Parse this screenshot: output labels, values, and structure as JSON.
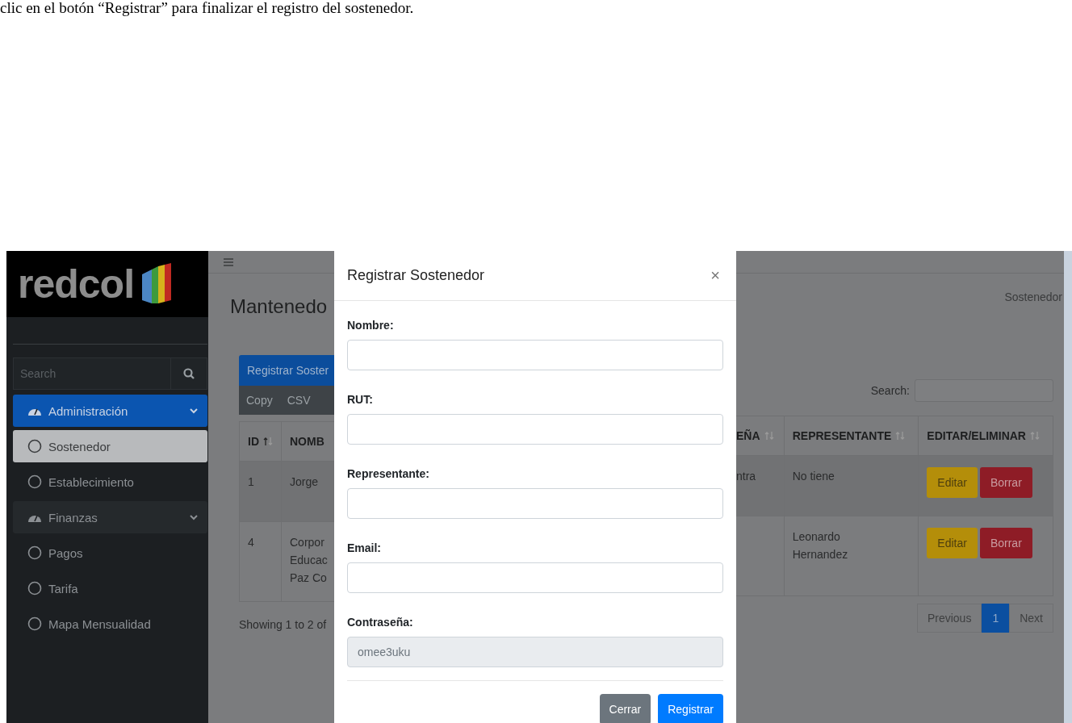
{
  "document_text": "clic en el botón “Registrar” para finalizar el registro del sostenedor.",
  "sidebar": {
    "logo": "redcol",
    "search": {
      "placeholder": "Search"
    },
    "items": [
      {
        "label": "Administración",
        "selected": true,
        "expanded": true,
        "children": [
          {
            "label": "Sostenedor",
            "selected": true
          },
          {
            "label": "Establecimiento",
            "selected": false
          }
        ]
      },
      {
        "label": "Finanzas",
        "selected": false,
        "expanded": true,
        "children": [
          {
            "label": "Pagos",
            "selected": false
          },
          {
            "label": "Tarifa",
            "selected": false
          },
          {
            "label": "Mapa Mensualidad",
            "selected": false
          }
        ]
      }
    ]
  },
  "page": {
    "title": "Mantenedo",
    "breadcrumb": "Sostenedor",
    "register_button": "Registrar Soster",
    "export_buttons": [
      "Copy",
      "CSV"
    ],
    "search_label": "Search:",
    "table_left": {
      "columns": [
        {
          "label": "ID",
          "sorted": true
        },
        {
          "label": "NOMB"
        }
      ],
      "rows": [
        {
          "cells": [
            "1",
            "Jorge"
          ]
        },
        {
          "cells": [
            "4",
            "Corpor\nEducac\nPaz Co"
          ]
        }
      ]
    },
    "table_right": {
      "columns": [
        {
          "label": "EÑA",
          "sorted": false
        },
        {
          "label": "REPRESENTANTE",
          "sorted": false
        },
        {
          "label": "EDITAR/ELIMINAR",
          "sorted": false
        }
      ],
      "rows": [
        {
          "cells": [
            "ntra",
            "No tiene"
          ],
          "actions": [
            "Editar",
            "Borrar"
          ]
        },
        {
          "cells": [
            "",
            "Leonardo\nHernandez"
          ],
          "actions": [
            "Editar",
            "Borrar"
          ]
        }
      ]
    },
    "info": "Showing 1 to 2 of",
    "pagination": [
      {
        "label": "Previous",
        "selected": false
      },
      {
        "label": "1",
        "selected": true
      },
      {
        "label": "Next",
        "selected": false
      }
    ]
  },
  "modal": {
    "title": "Registrar Sostenedor",
    "close": "×",
    "fields": [
      {
        "label": "Nombre:"
      },
      {
        "label": "RUT:"
      },
      {
        "label": "Representante:"
      },
      {
        "label": "Email:"
      },
      {
        "label": "Contraseña:",
        "value": "omee3uku",
        "readonly": true
      }
    ],
    "buttons": [
      {
        "label": "Cerrar",
        "kind": "secondary"
      },
      {
        "label": "Registrar",
        "kind": "primary"
      }
    ]
  }
}
